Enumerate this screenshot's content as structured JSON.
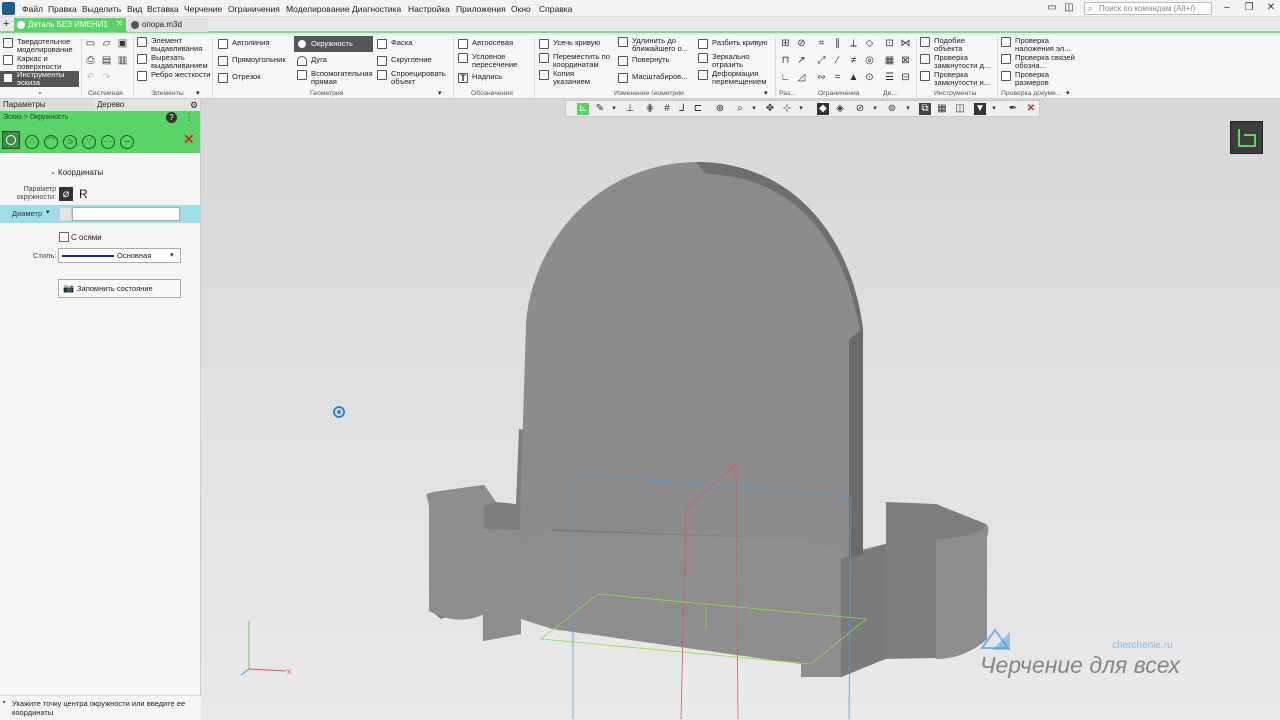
{
  "menu": [
    "Файл",
    "Правка",
    "Выделить",
    "Вид",
    "Вставка",
    "Черчение",
    "Ограничения",
    "Моделирование",
    "Диагностика",
    "Настройка",
    "Приложения",
    "Окно",
    "Справка"
  ],
  "search": {
    "placeholder": "Поиск по командам (Alt+/)"
  },
  "tabs": [
    {
      "label": "Деталь БЕЗ ИМЕНИ1",
      "active": true
    },
    {
      "label": "опора.m3d",
      "active": false
    }
  ],
  "ribbon": {
    "modes": [
      "Твердотельное моделирование",
      "Каркас и поверхности",
      "Инструменты эскиза"
    ],
    "elements": [
      "Элемент выдавливания",
      "Вырезать выдавливанием",
      "Ребро жесткости"
    ],
    "geometry": [
      "Автолиния",
      "Окружность",
      "Фаска",
      "Прямоугольник",
      "Дуга",
      "Скругление",
      "Отрезок",
      "Вспомогательная прямая",
      "Спроецировать объект"
    ],
    "notation": [
      "Автоосевая",
      "Условное пересечение",
      "Надпись"
    ],
    "edit": [
      "Усечь кривую",
      "Удлинить до ближайшего о...",
      "Разбить кривую",
      "Переместить по координатам",
      "Повернуть",
      "Зеркально отразить",
      "Копия указанием",
      "Масштабиров...",
      "Деформация перемещением"
    ],
    "tools": [
      "Подобие объекта",
      "Проверка замкнутости д...",
      "Проверка замкнутости и..."
    ],
    "checks": [
      "Проверка наложения эл...",
      "Проверка связей обозна...",
      "Проверка размеров"
    ],
    "group_titles": [
      "Системная",
      "Элементы",
      "Геометрия",
      "Обозначения",
      "Изменение геометрии",
      "Раз...",
      "Ограничения",
      "Ди...",
      "Инструменты",
      "Проверка докуме..."
    ]
  },
  "panel": {
    "tabs": [
      "Параметры",
      "Дерево"
    ],
    "breadcrumb": "Эскиз > Окружность",
    "section": "Координаты",
    "param_label": "Параметр окружности:",
    "param_r": "R",
    "diameter_label": "Диаметр",
    "axes_label": "С осями",
    "style_label": "Стиль:",
    "style_value": "Основная",
    "save_state": "Запомнить состояние",
    "status": "Укажите точку центра окружности или введите ее координаты"
  },
  "watermark": {
    "title": "Черчение для всех",
    "url": "cherchenie.ru"
  },
  "colors": {
    "accent_green": "#5ad467",
    "tab_green": "#8ad483",
    "model_gray": "#8e8e8e"
  }
}
